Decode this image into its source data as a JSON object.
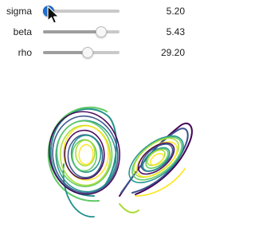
{
  "sliders": [
    {
      "id": "sigma",
      "label": "sigma",
      "value": "5.20",
      "position": 0.07,
      "active": true
    },
    {
      "id": "beta",
      "label": "beta",
      "value": "5.43",
      "position": 0.76,
      "active": false
    },
    {
      "id": "rho",
      "label": "rho",
      "value": "29.20",
      "position": 0.58,
      "active": false
    }
  ],
  "colors": {
    "track": "#c9c9c9",
    "fill": "#9e9e9e",
    "active_thumb": "#1f6fd1",
    "palette": [
      "#440154",
      "#3b528b",
      "#21918c",
      "#5ec962",
      "#a8db34",
      "#fde725"
    ]
  }
}
